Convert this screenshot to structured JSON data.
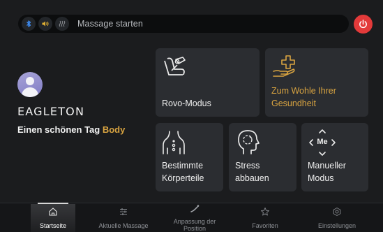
{
  "topbar": {
    "bluetooth_icon": "bluetooth-icon",
    "sound_icon": "speaker-icon",
    "heat_icon": "heat-icon",
    "search_label": "Massage starten",
    "power_icon": "power-icon"
  },
  "profile": {
    "name": "EAGLETON",
    "greeting": "Einen schönen Tag",
    "greeting_highlight": "Body"
  },
  "tiles": {
    "rovo": {
      "label": "Rovo-Modus",
      "icon": "chair-icon"
    },
    "health": {
      "label": "Zum Wohle Ihrer\nGesundheit",
      "icon": "hand-plus-icon"
    },
    "body_parts": {
      "label": "Bestimmte\nKörperteile",
      "icon": "body-icon"
    },
    "stress": {
      "label": "Stress\nabbauen",
      "icon": "head-icon"
    },
    "manual": {
      "label": "Manueller\nModus",
      "icon": "arrows-icon",
      "center_text": "Me"
    }
  },
  "nav": {
    "items": [
      {
        "label": "Startseite",
        "icon": "home-icon"
      },
      {
        "label": "Aktuelle Massage",
        "icon": "sliders-icon"
      },
      {
        "label": "Anpassung der Position",
        "icon": "recline-icon"
      },
      {
        "label": "Favoriten",
        "icon": "star-icon"
      },
      {
        "label": "Einstellungen",
        "icon": "settings-icon"
      }
    ],
    "active": 0
  },
  "colors": {
    "accent_gold": "#d9a441",
    "power_red": "#e33a3a",
    "bluetooth_blue": "#3e8ef7",
    "sound_yellow": "#e0b033"
  }
}
